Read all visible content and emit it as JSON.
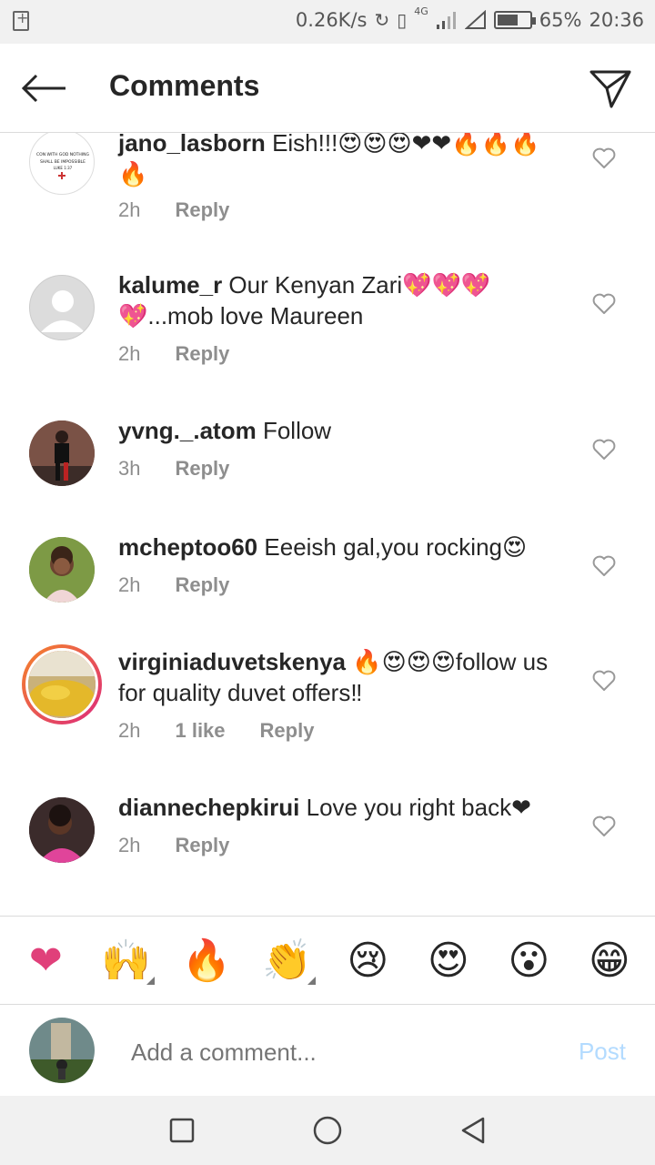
{
  "status_bar": {
    "net_speed": "0.26K/s",
    "network": "4G",
    "battery": "65%",
    "battery_level": 0.65,
    "time": "20:36"
  },
  "header": {
    "title": "Comments",
    "back_icon": "arrow-left-icon",
    "send_icon": "paper-plane-icon"
  },
  "comments": [
    {
      "user": "jano_lasborn",
      "text": "Eish!!!😍😍😍❤❤🔥🔥🔥🔥",
      "time": "2h",
      "reply": "Reply",
      "likes": ""
    },
    {
      "user": "kalume_r",
      "text": "Our Kenyan Zari💖💖💖💖...mob love Maureen",
      "time": "2h",
      "reply": "Reply",
      "likes": ""
    },
    {
      "user": "yvng._.atom",
      "text": "Follow",
      "time": "3h",
      "reply": "Reply",
      "likes": ""
    },
    {
      "user": "mcheptoo60",
      "text": "Eeeish gal,you rocking😍",
      "time": "2h",
      "reply": "Reply",
      "likes": ""
    },
    {
      "user": "virginiaduvetskenya",
      "text": "🔥😍😍😍follow us for quality duvet offers‼",
      "time": "2h",
      "reply": "Reply",
      "likes": "1 like"
    },
    {
      "user": "diannechepkirui",
      "text": "Love you right back❤",
      "time": "2h",
      "reply": "Reply",
      "likes": ""
    }
  ],
  "avatar_text": {
    "line1": "CON WITH GOD NOTHING",
    "line2": "SHALL BE IMPOSSIBLE",
    "line3": "LUKE 1:37"
  },
  "emoji_bar": [
    {
      "glyph": "❤",
      "name": "heart-emoji",
      "menu": false
    },
    {
      "glyph": "🙌",
      "name": "raised-hands-emoji",
      "menu": true
    },
    {
      "glyph": "🔥",
      "name": "fire-emoji",
      "menu": false
    },
    {
      "glyph": "👏",
      "name": "clapping-emoji",
      "menu": true
    },
    {
      "glyph": "😢",
      "name": "sad-emoji",
      "menu": false
    },
    {
      "glyph": "😍",
      "name": "heart-eyes-emoji",
      "menu": false
    },
    {
      "glyph": "😮",
      "name": "surprised-emoji",
      "menu": false
    },
    {
      "glyph": "😁",
      "name": "grin-emoji",
      "menu": false
    }
  ],
  "composer": {
    "placeholder": "Add a comment...",
    "post_label": "Post"
  },
  "colors": {
    "accent_post_disabled": "#b3dbff",
    "muted_text": "#8e8e8e",
    "story_ring_start": "#f58529",
    "story_ring_end": "#dd2a7b"
  }
}
